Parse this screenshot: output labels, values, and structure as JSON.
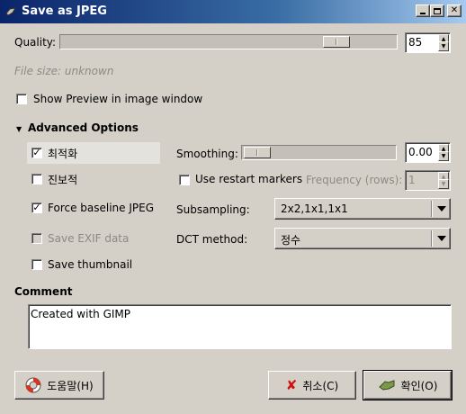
{
  "window": {
    "title": "Save as JPEG"
  },
  "quality": {
    "label": "Quality:",
    "value": "85"
  },
  "file_size": {
    "text": "File size: unknown"
  },
  "show_preview": {
    "label": "Show Preview in image window",
    "checked": false
  },
  "advanced": {
    "header": "Advanced Options",
    "optimize": {
      "label": "최적화",
      "checked": true
    },
    "progressive": {
      "label": "진보적",
      "checked": false
    },
    "force_baseline": {
      "label": "Force baseline JPEG",
      "checked": true
    },
    "save_exif": {
      "label": "Save EXIF data",
      "checked": false
    },
    "save_thumbnail": {
      "label": "Save thumbnail",
      "checked": false
    },
    "smoothing": {
      "label": "Smoothing:",
      "value": "0.00"
    },
    "restart_markers": {
      "label": "Use restart markers",
      "checked": false
    },
    "frequency": {
      "label": "Frequency (rows):",
      "value": "1"
    },
    "subsampling": {
      "label": "Subsampling:",
      "selected": "2x2,1x1,1x1"
    },
    "dct_method": {
      "label": "DCT method:",
      "selected": "정수"
    }
  },
  "comment": {
    "header": "Comment",
    "text": "Created with GIMP"
  },
  "buttons": {
    "help": "도움말(H)",
    "cancel": "취소(C)",
    "ok": "확인(O)"
  }
}
